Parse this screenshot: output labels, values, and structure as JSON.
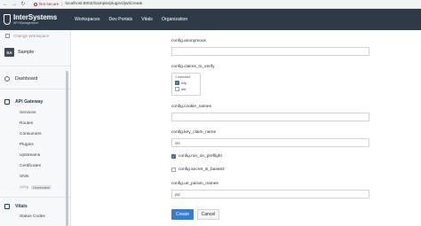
{
  "browser": {
    "security_label": "Not secure",
    "url": "localhost:8002/Sample/plugins/jwt/create"
  },
  "brand": {
    "name": "InterSystems",
    "subtitle": "API Management"
  },
  "nav": {
    "items": [
      "Workspaces",
      "Dev Portals",
      "Vitals",
      "Organization"
    ]
  },
  "sidebar": {
    "change_workspace": "Change Workspace",
    "workspace": {
      "badge": "SA",
      "name": "Sample"
    },
    "dashboard": "Dashboard",
    "api_gateway": "API Gateway",
    "api_items": [
      "Services",
      "Routes",
      "Consumers",
      "Plugins",
      "Upstreams",
      "Certificates",
      "SNIs"
    ],
    "apis": {
      "label": "APIs",
      "badge": "Deprecated"
    },
    "vitals": "Vitals",
    "vitals_items": [
      "Status Codes"
    ]
  },
  "form": {
    "anonymous": {
      "label": "config.anonymous",
      "value": ""
    },
    "claims_to_verify": {
      "label": "config.claims_to_verify",
      "selected_count": "1 selected",
      "options": [
        {
          "label": "exp",
          "checked": true
        },
        {
          "label": "nbf",
          "checked": false
        }
      ]
    },
    "cookie_names": {
      "label": "config.cookie_names",
      "value": ""
    },
    "key_claim_name": {
      "label": "config.key_claim_name",
      "value": "iss"
    },
    "run_on_preflight": {
      "label": "config.run_on_preflight",
      "checked": true
    },
    "secret_is_base64": {
      "label": "config.secret_is_base64",
      "checked": false
    },
    "uri_param_names": {
      "label": "config.uri_param_names",
      "value": "jwt"
    },
    "create_label": "Create",
    "cancel_label": "Cancel"
  },
  "colors": {
    "nav_bg": "#2d3b48",
    "primary": "#2f7fd6",
    "warning": "#c5221f"
  }
}
